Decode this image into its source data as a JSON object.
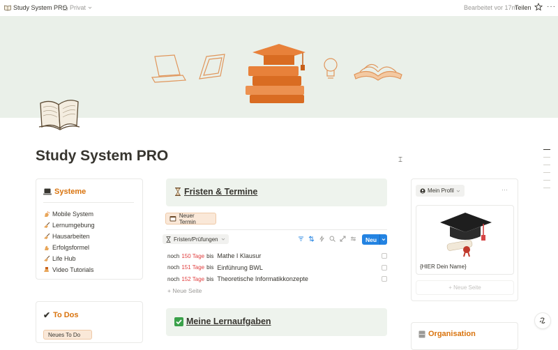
{
  "topbar": {
    "page_title": "Study System PRO",
    "privacy": "Privat",
    "edited": "Bearbeitet vor 17m",
    "share": "Teilen"
  },
  "page": {
    "title": "Study System PRO"
  },
  "systeme": {
    "heading": "Systeme",
    "items": [
      {
        "label": "Mobile System",
        "icon": "sparkle-hand-icon"
      },
      {
        "label": "Lernumgebung",
        "icon": "writing-hand-icon"
      },
      {
        "label": "Hausarbeiten",
        "icon": "writing-hand-icon"
      },
      {
        "label": "Erfolgsformel",
        "icon": "flexed-biceps-icon"
      },
      {
        "label": "Life Hub",
        "icon": "writing-hand-icon"
      },
      {
        "label": "Video Tutorials",
        "icon": "video-hand-icon"
      }
    ]
  },
  "todos": {
    "heading": "To Dos",
    "button": "Neues To Do"
  },
  "fristen": {
    "heading": "Fristen & Termine",
    "new_button": "Neuer Termin",
    "view_name": "Fristen/Prüfungen",
    "new_label": "Neu",
    "rows": [
      {
        "prefix": "noch",
        "days": "150 Tage",
        "suffix": "bis",
        "task": "Mathe I Klausur"
      },
      {
        "prefix": "noch",
        "days": "151 Tage",
        "suffix": "bis",
        "task": "Einführung BWL"
      },
      {
        "prefix": "noch",
        "days": "152 Tage",
        "suffix": "bis",
        "task": "Theoretische Informatikkonzepte"
      }
    ],
    "add_page": "Neue Seite"
  },
  "lernaufgaben": {
    "heading": "Meine Lernaufgaben"
  },
  "profil": {
    "tab": "Mein Profil",
    "name": "{HIER Dein Name}",
    "add_page": "Neue Seite"
  },
  "organisation": {
    "heading": "Organisation"
  },
  "colors": {
    "accent": "#d9730d",
    "days_red": "#e03e3e",
    "primary_button": "#2383e2",
    "cover_bg": "#eaf0e9"
  }
}
